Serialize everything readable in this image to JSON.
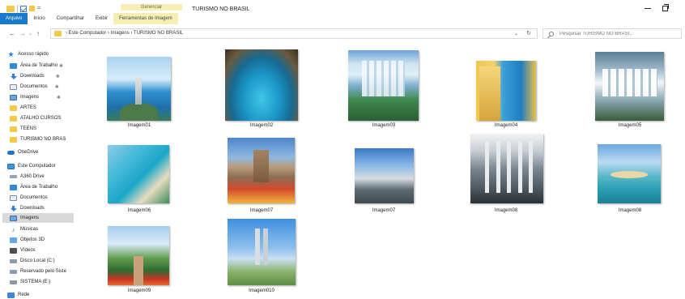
{
  "quick_access_toolbar": {
    "arrow": "="
  },
  "ribbon": {
    "context_group": "Gerenciar",
    "tabs": [
      "Arquivo",
      "Início",
      "Compartilhar",
      "Exibir",
      "Ferramentas de Imagem"
    ]
  },
  "window": {
    "title": "TURISMO NO BRASIL"
  },
  "address": {
    "crumbs": "›  Este Computador  ›  Imagens  ›  TURISMO NO BRASIL",
    "search_placeholder": "Pesquisar TURISMO NO BRASI..."
  },
  "nav": {
    "items": [
      {
        "label": "Acesso rápido",
        "icon": "star-icon",
        "pinned": false
      },
      {
        "label": "Área de Trabalho",
        "icon": "desktop-icon",
        "pinned": true
      },
      {
        "label": "Downloads",
        "icon": "download-icon",
        "pinned": true
      },
      {
        "label": "Documentos",
        "icon": "documents-icon",
        "pinned": true
      },
      {
        "label": "Imagens",
        "icon": "images-icon",
        "pinned": true
      },
      {
        "label": "ARTES",
        "icon": "folder-icon",
        "pinned": false
      },
      {
        "label": "ATALHO CURSOS",
        "icon": "folder-icon",
        "pinned": false
      },
      {
        "label": "TEENS",
        "icon": "folder-icon",
        "pinned": false
      },
      {
        "label": "TURISMO NO BRAS",
        "icon": "folder-icon",
        "pinned": false
      },
      {
        "label": "OneDrive",
        "icon": "onedrive-icon",
        "pinned": false
      },
      {
        "label": "Este Computador",
        "icon": "computer-icon",
        "pinned": false
      },
      {
        "label": "A360 Drive",
        "icon": "drive-icon",
        "pinned": false
      },
      {
        "label": "Área de Trabalho",
        "icon": "desktop-icon",
        "pinned": false
      },
      {
        "label": "Documentos",
        "icon": "documents-icon",
        "pinned": false
      },
      {
        "label": "Downloads",
        "icon": "download-icon",
        "pinned": false
      },
      {
        "label": "Imagens",
        "icon": "images-icon",
        "pinned": false
      },
      {
        "label": "Músicas",
        "icon": "music-icon",
        "pinned": false
      },
      {
        "label": "Objetos 3D",
        "icon": "objects-3d-icon",
        "pinned": false
      },
      {
        "label": "Vídeos",
        "icon": "videos-icon",
        "pinned": false
      },
      {
        "label": "Disco Local (C:)",
        "icon": "local-disk-icon",
        "pinned": false
      },
      {
        "label": "Reservado pelo Siste",
        "icon": "disk-icon",
        "pinned": false
      },
      {
        "label": "SISTEMA (E:)",
        "icon": "disk-icon",
        "pinned": false
      },
      {
        "label": "Rede",
        "icon": "network-icon",
        "pinned": false
      }
    ],
    "pin_glyph": "✱"
  },
  "files": [
    {
      "name": "Imagem01"
    },
    {
      "name": "Imagem02"
    },
    {
      "name": "Imagem03"
    },
    {
      "name": "Imagem04"
    },
    {
      "name": "Imagem05"
    },
    {
      "name": "Imagem06"
    },
    {
      "name": "Imagem07"
    },
    {
      "name": "Imagem07"
    },
    {
      "name": "Imagem08"
    },
    {
      "name": "Imagem08"
    },
    {
      "name": "Imagem09"
    },
    {
      "name": "Imagem010"
    }
  ]
}
